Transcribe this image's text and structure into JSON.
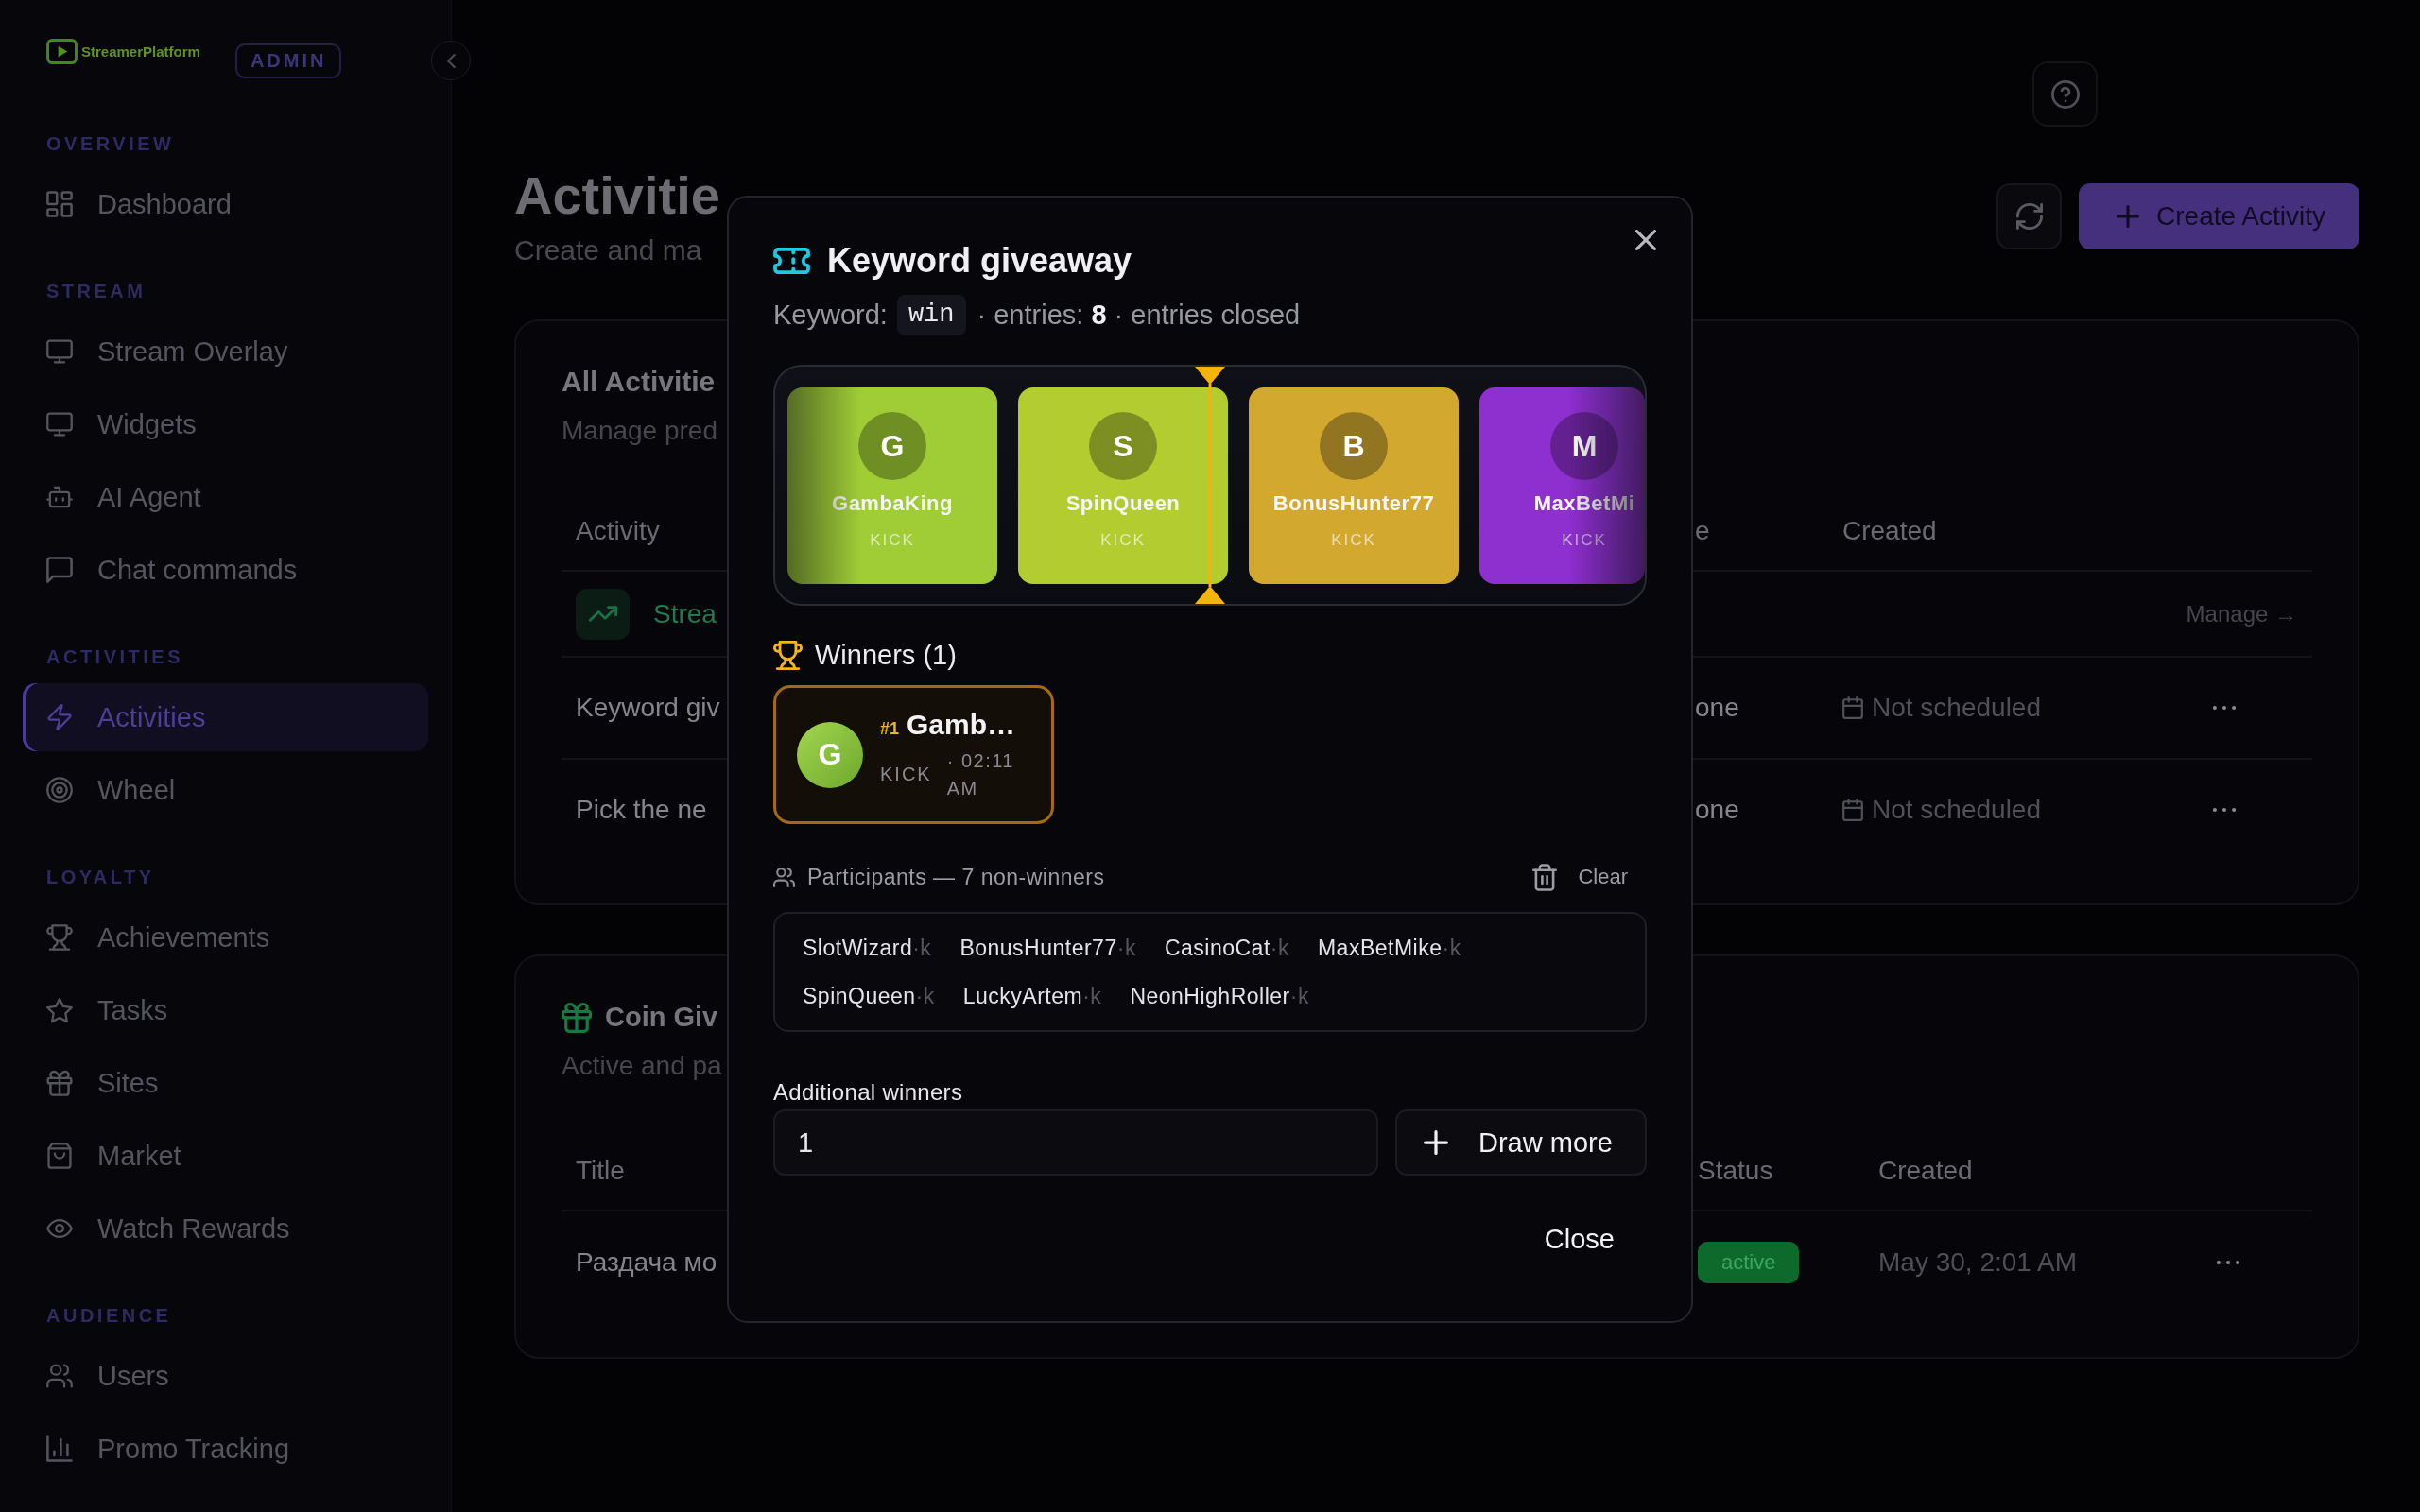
{
  "sidebar": {
    "logo": "StreamerPlatform",
    "role_badge": "ADMIN",
    "sections": [
      {
        "title": "OVERVIEW",
        "items": [
          {
            "label": "Dashboard",
            "selected": false
          }
        ]
      },
      {
        "title": "STREAM",
        "items": [
          {
            "label": "Stream Overlay",
            "selected": false
          },
          {
            "label": "Widgets",
            "selected": false
          },
          {
            "label": "AI Agent",
            "selected": false
          },
          {
            "label": "Chat commands",
            "selected": false
          }
        ]
      },
      {
        "title": "ACTIVITIES",
        "items": [
          {
            "label": "Activities",
            "selected": true
          },
          {
            "label": "Wheel",
            "selected": false
          }
        ]
      },
      {
        "title": "LOYALTY",
        "items": [
          {
            "label": "Achievements",
            "selected": false
          },
          {
            "label": "Tasks",
            "selected": false
          },
          {
            "label": "Sites",
            "selected": false
          },
          {
            "label": "Market",
            "selected": false
          },
          {
            "label": "Watch Rewards",
            "selected": false
          }
        ]
      },
      {
        "title": "AUDIENCE",
        "items": [
          {
            "label": "Users",
            "selected": false
          },
          {
            "label": "Promo Tracking",
            "selected": false
          }
        ]
      }
    ]
  },
  "page": {
    "title": "Activitie",
    "subtitle": "Create and ma",
    "create_button": "Create Activity"
  },
  "activities_card": {
    "title": "All Activitie",
    "subtitle": "Manage pred",
    "columns": [
      "Activity",
      "e",
      "Created"
    ],
    "rows": [
      {
        "kind": "featured",
        "activity": "Strea",
        "action": "Manage →"
      },
      {
        "kind": "plain",
        "activity": "Keyword giv",
        "column_2": "one",
        "created": "Not scheduled"
      },
      {
        "kind": "plain",
        "activity": "Pick the ne",
        "column_2": "one",
        "created": "Not scheduled"
      }
    ]
  },
  "giveaways_card": {
    "title": "Coin Giv",
    "subtitle": "Active and pa",
    "columns": [
      "Title",
      "Status",
      "Created"
    ],
    "rows": [
      {
        "title": "Раздача мо",
        "status": "active",
        "created": "May 30, 2:01 AM"
      }
    ]
  },
  "modal": {
    "title": "Keyword giveaway",
    "keyword_label": "Keyword:",
    "keyword": "win",
    "summary": "· entries: **8** · entries closed",
    "reel": [
      {
        "initial": "G",
        "name": "GambaKing",
        "platform": "KICK",
        "color": "#a0cd36"
      },
      {
        "initial": "S",
        "name": "SpinQueen",
        "platform": "KICK",
        "color": "#b3cd31"
      },
      {
        "initial": "B",
        "name": "BonusHunter77",
        "platform": "KICK",
        "color": "#d2a82f"
      },
      {
        "initial": "M",
        "name": "MaxBetMi",
        "platform": "KICK",
        "color": "#8e2fcf"
      }
    ],
    "winners_title": "Winners (1)",
    "winners": [
      {
        "initial": "G",
        "rank": "#1",
        "name": "Gamb…",
        "platform": "KICK",
        "time": "· 02:11 AM"
      }
    ],
    "participants_title": "Participants — 7 non-winners",
    "clear_button": "Clear",
    "participants": [
      {
        "name": "SlotWizard",
        "tag": "·k"
      },
      {
        "name": "BonusHunter77",
        "tag": "·k"
      },
      {
        "name": "CasinoCat",
        "tag": "·k"
      },
      {
        "name": "MaxBetMike",
        "tag": "·k"
      },
      {
        "name": "SpinQueen",
        "tag": "·k"
      },
      {
        "name": "LuckyArtem",
        "tag": "·k"
      },
      {
        "name": "NeonHighRoller",
        "tag": "·k"
      }
    ],
    "additional_label": "Additional winners",
    "additional_value": "1",
    "draw_button": "Draw more",
    "close_button": "Close"
  }
}
